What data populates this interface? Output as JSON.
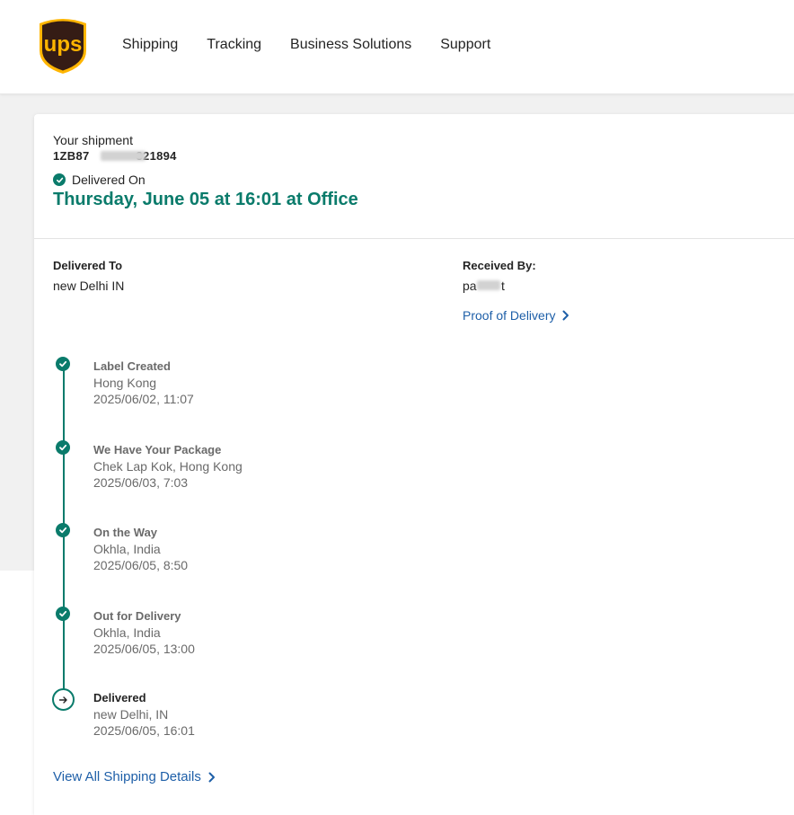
{
  "header": {
    "logo_text": "ups",
    "nav": [
      "Shipping",
      "Tracking",
      "Business Solutions",
      "Support"
    ]
  },
  "shipment": {
    "heading": "Your shipment",
    "tracking_prefix": "1ZB87",
    "tracking_suffix": "321894",
    "status_label": "Delivered On",
    "delivery_date": "Thursday, June 05 at 16:01 at Office"
  },
  "delivered_to": {
    "label": "Delivered To",
    "value": "new Delhi IN"
  },
  "received_by": {
    "label": "Received By:",
    "value_prefix": "pa",
    "value_suffix": "t"
  },
  "proof_link": "Proof of Delivery",
  "timeline": [
    {
      "title": "Label Created",
      "location": "Hong Kong",
      "time": "2025/06/02, 11:07"
    },
    {
      "title": "We Have Your Package",
      "location": "Chek Lap Kok, Hong Kong",
      "time": "2025/06/03, 7:03"
    },
    {
      "title": "On the Way",
      "location": "Okhla, India",
      "time": "2025/06/05, 8:50"
    },
    {
      "title": "Out for Delivery",
      "location": "Okhla, India",
      "time": "2025/06/05, 13:00"
    },
    {
      "title": "Delivered",
      "location": "new Delhi, IN",
      "time": "2025/06/05, 16:01"
    }
  ],
  "all_details_link": "View All Shipping Details",
  "colors": {
    "brand_brown": "#351c15",
    "brand_gold": "#ffb500",
    "accent_teal": "#0a7b6b",
    "link_blue": "#1e5fa8"
  }
}
